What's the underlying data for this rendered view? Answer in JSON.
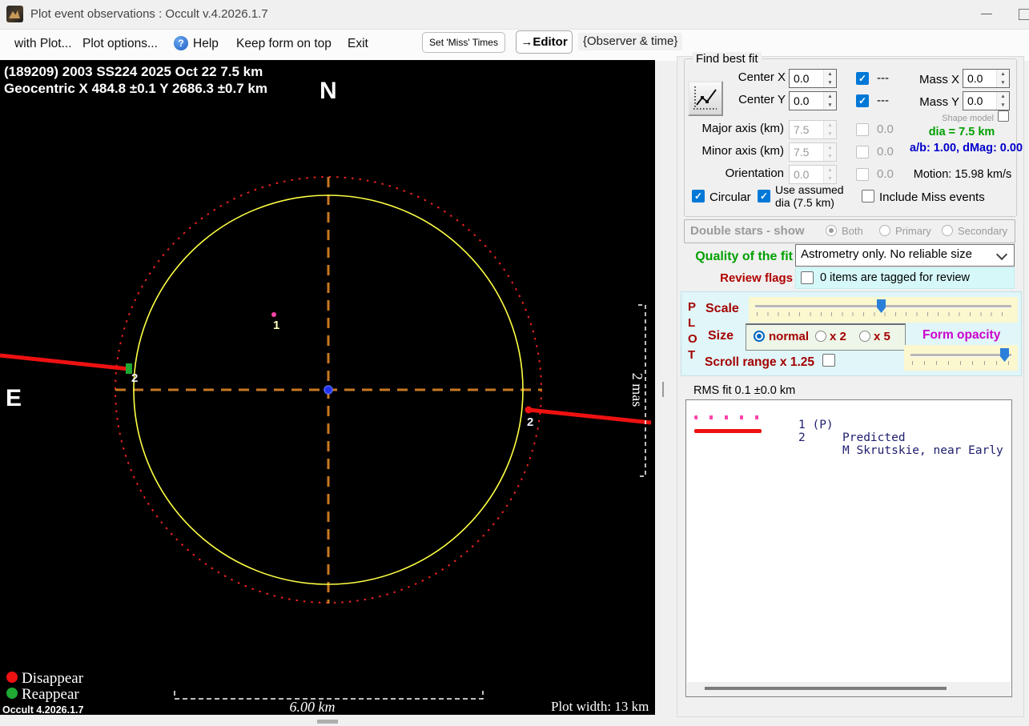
{
  "window": {
    "title": "Plot event observations : Occult v.4.2026.1.7"
  },
  "icons": {
    "help": "?",
    "minimize": "—",
    "spin_up": "▲",
    "spin_down": "▼"
  },
  "menu": {
    "with_plot": "with Plot...",
    "plot_options": "Plot options...",
    "help": "Help",
    "keep_on_top": "Keep form on top",
    "exit": "Exit",
    "set_miss_times": "Set 'Miss' Times",
    "editor": "→Editor",
    "observer_time": "{Observer & time}"
  },
  "plot": {
    "line1": "(189209) 2003 SS224  2025 Oct 22  7.5 km",
    "line2": "Geocentric  X  484.8 ±0.1  Y 2686.3 ±0.7 km",
    "north": "N",
    "east": "E",
    "mas_scale": "2 mas",
    "scale_bar": "6.00 km",
    "plot_width": "Plot width: 13 km",
    "disappear": "Disappear",
    "reappear": "Reappear",
    "version": "Occult 4.2026.1.7",
    "marker1": "1",
    "marker2_left": "2",
    "marker2_right": "2"
  },
  "fit": {
    "group_label": "Find best fit",
    "center_x": {
      "label": "Center X",
      "value": "0.0"
    },
    "center_y": {
      "label": "Center Y",
      "value": "0.0"
    },
    "dash": "---",
    "mass_x": {
      "label": "Mass X",
      "value": "0.0"
    },
    "mass_y": {
      "label": "Mass Y",
      "value": "0.0"
    },
    "shape_model": "Shape model",
    "major": {
      "label": "Major axis (km)",
      "value": "7.5"
    },
    "minor": {
      "label": "Minor axis (km)",
      "value": "7.5"
    },
    "orientation": {
      "label": "Orientation",
      "value": "0.0"
    },
    "zero": "0.0",
    "dia": "dia = 7.5 km",
    "ab": "a/b: 1.00, dMag: 0.00",
    "motion": "Motion: 15.98 km/s",
    "circular": "Circular",
    "use_assumed_1": "Use assumed",
    "use_assumed_2": "dia (7.5 km)",
    "include_miss": "Include Miss events"
  },
  "double_stars": {
    "label": "Double stars - show",
    "both": "Both",
    "primary": "Primary",
    "secondary": "Secondary"
  },
  "quality": {
    "label": "Quality of the fit",
    "value": "Astrometry only. No reliable size"
  },
  "review": {
    "label": "Review flags",
    "text": "0 items are tagged for review"
  },
  "plot_controls": {
    "p": "P",
    "l": "L",
    "o": "O",
    "t": "T",
    "scale": "Scale",
    "size": "Size",
    "normal": "normal",
    "x2": "x 2",
    "x5": "x 5",
    "form_opacity": "Form opacity",
    "scroll_range": "Scroll range x 1.25"
  },
  "rms": "RMS fit 0.1 ±0.0 km",
  "observations": [
    {
      "num": "1 (P)",
      "name": "Predicted"
    },
    {
      "num": "2",
      "name": "M Skrutskie, near Early"
    }
  ],
  "colors": {
    "asteroid_circle": "#ffff44",
    "uncertainty_circle": "#ee2222",
    "crosshair": "#c87820",
    "chord": "#ee1111",
    "disappear_marker": "#ee1111",
    "reappear_marker": "#1fa832",
    "predicted_point": "#ff44aa",
    "center_dot": "#2233ee",
    "accent_checked": "#0078d7"
  }
}
